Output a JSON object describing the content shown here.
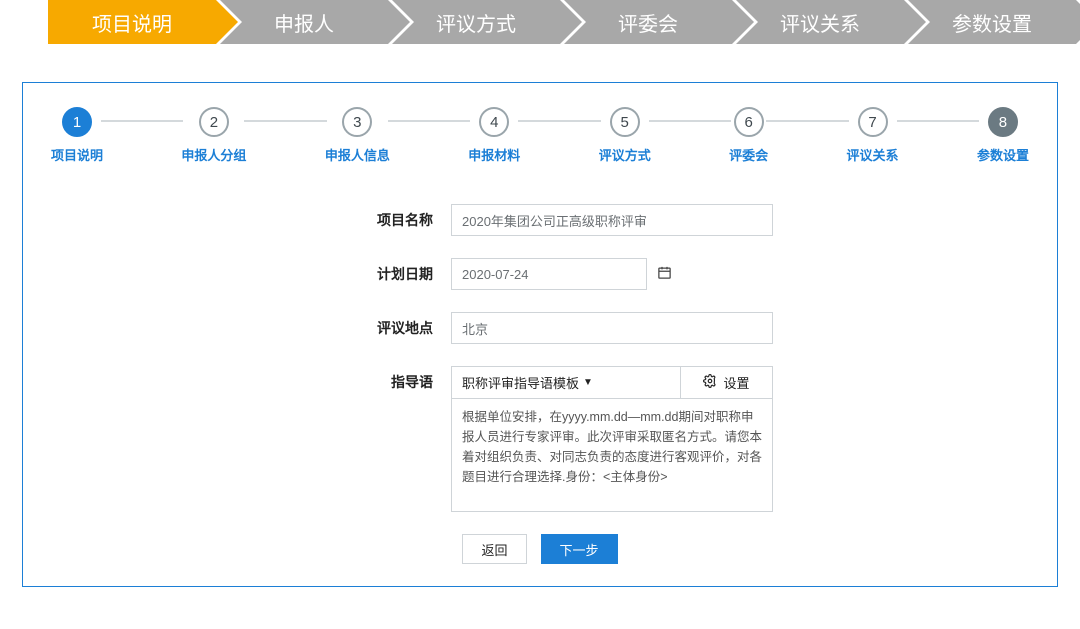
{
  "arrowNav": [
    "项目说明",
    "申报人",
    "评议方式",
    "评委会",
    "评议关系",
    "参数设置"
  ],
  "arrowActiveIndex": 0,
  "steps": [
    {
      "num": "1",
      "label": "项目说明"
    },
    {
      "num": "2",
      "label": "申报人分组"
    },
    {
      "num": "3",
      "label": "申报人信息"
    },
    {
      "num": "4",
      "label": "申报材料"
    },
    {
      "num": "5",
      "label": "评议方式"
    },
    {
      "num": "6",
      "label": "评委会"
    },
    {
      "num": "7",
      "label": "评议关系"
    },
    {
      "num": "8",
      "label": "参数设置"
    }
  ],
  "currentStepIndex": 0,
  "form": {
    "projectName": {
      "label": "项目名称",
      "value": "2020年集团公司正高级职称评审"
    },
    "planDate": {
      "label": "计划日期",
      "value": "2020-07-24"
    },
    "location": {
      "label": "评议地点",
      "value": "北京"
    },
    "guide": {
      "label": "指导语",
      "templateBtn": "职称评审指导语模板",
      "settingsBtn": "设置",
      "text": "根据单位安排，在yyyy.mm.dd—mm.dd期间对职称申报人员进行专家评审。此次评审采取匿名方式。请您本着对组织负责、对同志负责的态度进行客观评价，对各题目进行合理选择.身份：<主体身份>"
    }
  },
  "buttons": {
    "back": "返回",
    "next": "下一步"
  },
  "icons": {
    "calendar": "calendar-icon",
    "gear": "gear-icon",
    "caret": "caret-down-icon"
  }
}
